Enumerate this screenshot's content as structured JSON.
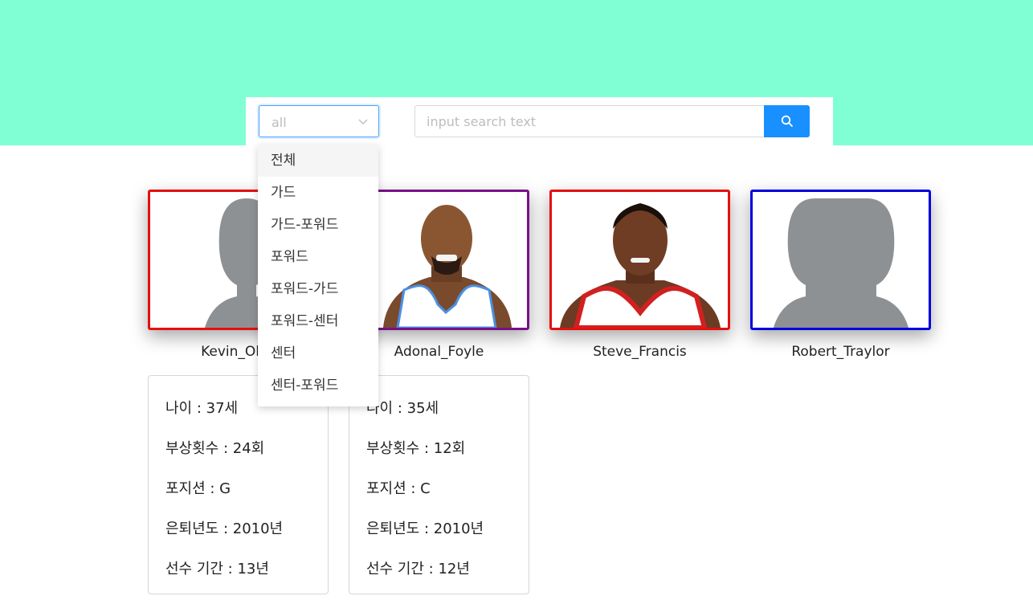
{
  "filter": {
    "selected_value": "all",
    "options": [
      "전체",
      "가드",
      "가드-포워드",
      "포워드",
      "포워드-가드",
      "포워드-센터",
      "센터",
      "센터-포워드"
    ]
  },
  "search": {
    "placeholder": "input search text",
    "value": "",
    "button_icon": "search-icon"
  },
  "colors": {
    "banner": "#80ffd4",
    "accent": "#1890ff",
    "card_red": "#e60f0f",
    "card_purple": "#7a0f8a",
    "card_blue": "#0000e0"
  },
  "players": [
    {
      "name": "Kevin_Ollie",
      "border": "#e60f0f",
      "photo": "silhouette",
      "details": {
        "age": "나이 : 37세",
        "injuries": "부상횟수 : 24회",
        "position": "포지션 : G",
        "retired": "은퇴년도 : 2010년",
        "career": "선수 기간 : 13년"
      }
    },
    {
      "name": "Adonal_Foyle",
      "border": "#7a0f8a",
      "photo": "player-photo",
      "details": {
        "age": "나이 : 35세",
        "injuries": "부상횟수 : 12회",
        "position": "포지션 : C",
        "retired": "은퇴년도 : 2010년",
        "career": "선수 기간 : 12년"
      }
    },
    {
      "name": "Steve_Francis",
      "border": "#e60f0f",
      "photo": "player-photo"
    },
    {
      "name": "Robert_Traylor",
      "border": "#0000e0",
      "photo": "silhouette"
    }
  ]
}
